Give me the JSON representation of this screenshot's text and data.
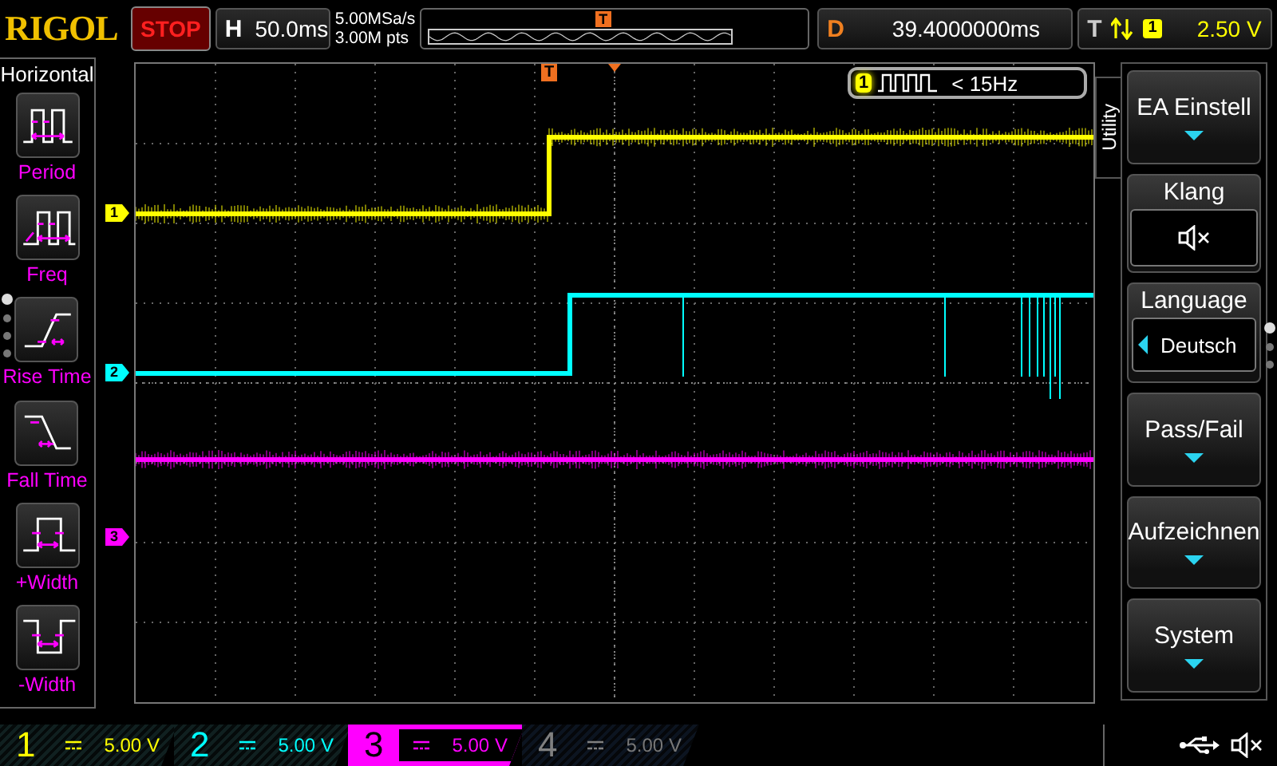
{
  "top_bar": {
    "logo": "RIGOL",
    "run_state": "STOP",
    "timebase": {
      "label": "H",
      "value": "50.0ms"
    },
    "sample_rate": "5.00MSa/s",
    "memory_depth": "3.00M pts",
    "memory_trigger_marker": "T",
    "delay": {
      "label": "D",
      "value": "39.4000000ms"
    },
    "trigger": {
      "label": "T",
      "source": "1",
      "level": "2.50 V"
    }
  },
  "left_menu": {
    "title": "Horizontal",
    "items": [
      {
        "label": "Period",
        "kind": "period"
      },
      {
        "label": "Freq",
        "kind": "freq"
      },
      {
        "label": "Rise Time",
        "kind": "rise"
      },
      {
        "label": "Fall Time",
        "kind": "fall"
      },
      {
        "label": "+Width",
        "kind": "pwidth"
      },
      {
        "label": "-Width",
        "kind": "nwidth"
      }
    ],
    "pages": [
      {
        "selected": true
      },
      {
        "selected": false
      },
      {
        "selected": false
      },
      {
        "selected": false
      }
    ]
  },
  "display": {
    "trigger_marker": "T",
    "channel_markers": [
      {
        "label": "1",
        "color": "#ffff00"
      },
      {
        "label": "2",
        "color": "#00ffff"
      },
      {
        "label": "3",
        "color": "#ff00ff"
      }
    ],
    "counter": {
      "channel": "1",
      "reading": "< 15Hz"
    }
  },
  "right_menu": {
    "tab": "Utility",
    "items": [
      {
        "label": "EA Einstell",
        "kind": "submenu"
      },
      {
        "label": "Klang",
        "kind": "sound",
        "muted": true
      },
      {
        "label": "Language",
        "kind": "choice",
        "value": "Deutsch"
      },
      {
        "label": "Pass/Fail",
        "kind": "submenu"
      },
      {
        "label": "Aufzeichnen",
        "kind": "submenu"
      },
      {
        "label": "System",
        "kind": "submenu"
      }
    ],
    "pages": [
      {
        "selected": true
      },
      {
        "selected": false
      },
      {
        "selected": false
      }
    ]
  },
  "channels": [
    {
      "number": "1",
      "scale": "5.00 V",
      "color": "#ffff00",
      "enabled": true,
      "selected": false
    },
    {
      "number": "2",
      "scale": "5.00 V",
      "color": "#00ffff",
      "enabled": true,
      "selected": false
    },
    {
      "number": "3",
      "scale": "5.00 V",
      "color": "#ff00ff",
      "enabled": true,
      "selected": true
    },
    {
      "number": "4",
      "scale": "5.00 V",
      "color": "#808080",
      "enabled": false,
      "selected": false
    }
  ]
}
